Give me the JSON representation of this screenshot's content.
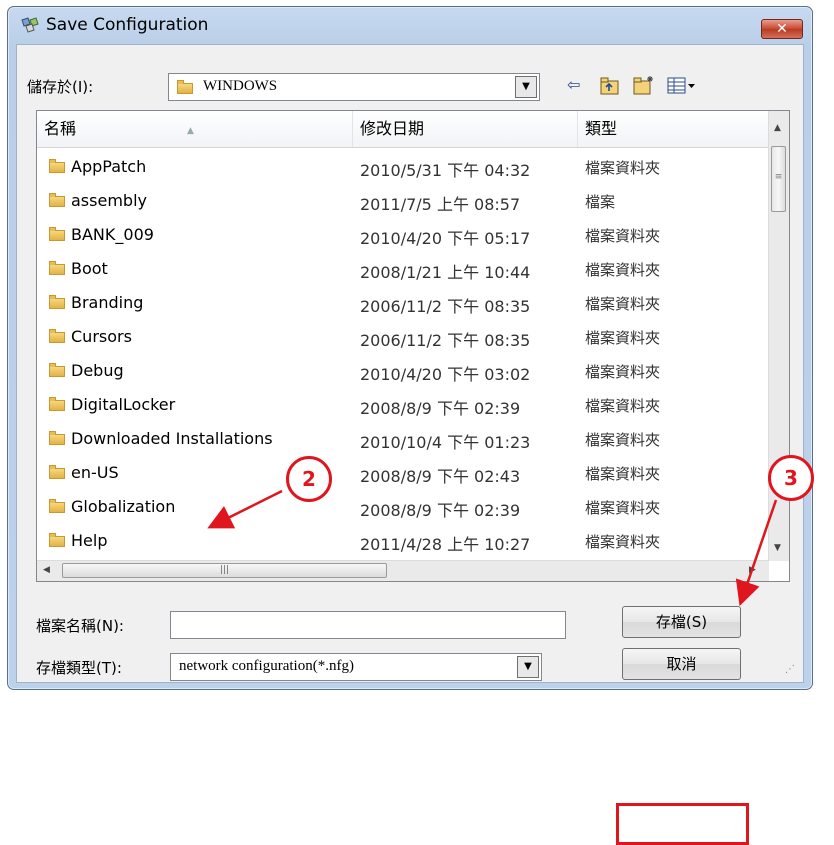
{
  "window": {
    "title": "Save Configuration",
    "close_symbol": "✕"
  },
  "location": {
    "label": "儲存於(I):",
    "value": "WINDOWS"
  },
  "toolbar": {
    "back_icon": "back-arrow-icon",
    "up_icon": "up-folder-icon",
    "new_folder_icon": "new-folder-icon",
    "view_icon": "view-menu-icon"
  },
  "columns": [
    "名稱",
    "修改日期",
    "類型"
  ],
  "files": [
    {
      "name": "AppPatch",
      "date": "2010/5/31 下午 04:32",
      "type": "檔案資料夾"
    },
    {
      "name": "assembly",
      "date": "2011/7/5 上午 08:57",
      "type": "檔案"
    },
    {
      "name": "BANK_009",
      "date": "2010/4/20 下午 05:17",
      "type": "檔案資料夾"
    },
    {
      "name": "Boot",
      "date": "2008/1/21 上午 10:44",
      "type": "檔案資料夾"
    },
    {
      "name": "Branding",
      "date": "2006/11/2 下午 08:35",
      "type": "檔案資料夾"
    },
    {
      "name": "Cursors",
      "date": "2006/11/2 下午 08:35",
      "type": "檔案資料夾"
    },
    {
      "name": "Debug",
      "date": "2010/4/20 下午 03:02",
      "type": "檔案資料夾"
    },
    {
      "name": "DigitalLocker",
      "date": "2008/8/9 下午 02:39",
      "type": "檔案資料夾"
    },
    {
      "name": "Downloaded Installations",
      "date": "2010/10/4 下午 01:23",
      "type": "檔案資料夾"
    },
    {
      "name": "en-US",
      "date": "2008/8/9 下午 02:43",
      "type": "檔案資料夾"
    },
    {
      "name": "Globalization",
      "date": "2008/8/9 下午 02:39",
      "type": "檔案資料夾"
    },
    {
      "name": "Help",
      "date": "2011/4/28 上午 10:27",
      "type": "檔案資料夾"
    }
  ],
  "filename": {
    "label": "檔案名稱(N):",
    "value": ""
  },
  "filetype": {
    "label": "存檔類型(T):",
    "value": "network configuration(*.nfg)"
  },
  "buttons": {
    "save": "存檔(S)",
    "cancel": "取消"
  },
  "callouts": {
    "two": "2",
    "three": "3"
  },
  "colors": {
    "annotation_red": "#e0161e",
    "title_bar": "#b9cfe8"
  }
}
